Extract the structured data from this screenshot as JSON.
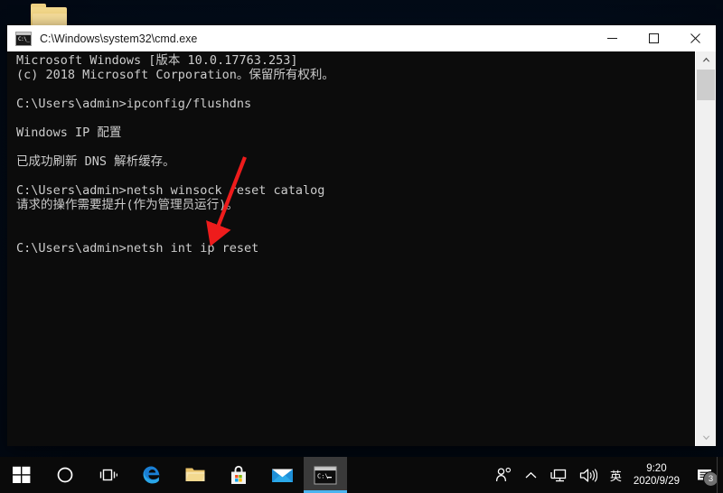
{
  "desktop": {
    "icon_name": "folder-icon"
  },
  "window": {
    "title": "C:\\Windows\\system32\\cmd.exe",
    "icon": "cmd-icon",
    "icon_prompt": "C:\\_",
    "controls": {
      "minimize": "minimize-icon",
      "maximize": "maximize-icon",
      "close": "close-icon"
    }
  },
  "console": {
    "lines": [
      "Microsoft Windows [版本 10.0.17763.253]",
      "(c) 2018 Microsoft Corporation。保留所有权利。",
      "",
      "C:\\Users\\admin>ipconfig/flushdns",
      "",
      "Windows IP 配置",
      "",
      "已成功刷新 DNS 解析缓存。",
      "",
      "C:\\Users\\admin>netsh winsock reset catalog",
      "请求的操作需要提升(作为管理员运行)。",
      "",
      "",
      "C:\\Users\\admin>netsh int ip reset"
    ],
    "foreground_color": "#cccccc",
    "background_color": "#0c0c0c"
  },
  "scrollbar": {
    "up_arrow": "scroll-up-icon",
    "down_arrow": "scroll-down-icon"
  },
  "annotation": {
    "arrow_color": "#ee1c1c",
    "from": "270,175",
    "to": "236,262"
  },
  "taskbar": {
    "items": [
      {
        "name": "start-button",
        "icon": "windows-logo-icon",
        "active": false
      },
      {
        "name": "cortana-button",
        "icon": "cortana-circle-icon",
        "active": false
      },
      {
        "name": "task-view-button",
        "icon": "task-view-icon",
        "active": false
      },
      {
        "name": "edge-button",
        "icon": "edge-icon",
        "active": false
      },
      {
        "name": "file-explorer-button",
        "icon": "folder-icon",
        "active": false
      },
      {
        "name": "microsoft-store-button",
        "icon": "store-bag-icon",
        "active": false
      },
      {
        "name": "mail-button",
        "icon": "mail-envelope-icon",
        "active": false
      },
      {
        "name": "cmd-taskbar-button",
        "icon": "cmd-icon",
        "active": true
      }
    ],
    "tray": {
      "people_icon": "people-icon",
      "overflow_icon": "chevron-up-icon",
      "network_icon": "network-monitor-icon",
      "volume_icon": "speaker-icon",
      "ime_label": "英",
      "clock_time": "9:20",
      "clock_date": "2020/9/29",
      "notification_icon": "notification-icon",
      "notification_count": "3"
    }
  }
}
